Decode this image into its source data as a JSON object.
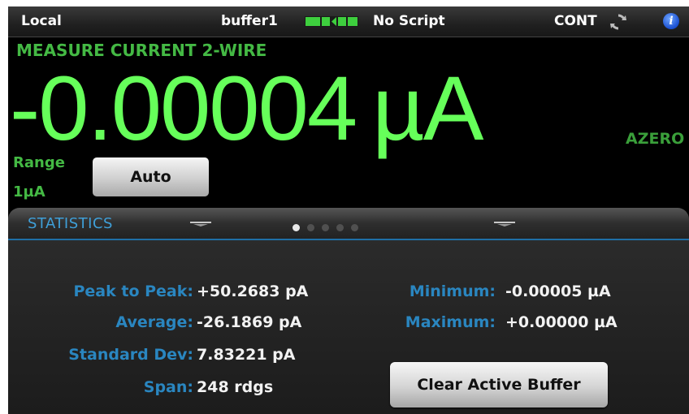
{
  "status_bar": {
    "mode": "Local",
    "buffer": "buffer1",
    "script": "No Script",
    "trigger": "CONT"
  },
  "icons": {
    "buffer": "buffer-fill-icon",
    "trigger": "continuous-trigger-icon",
    "info": "info-icon"
  },
  "measure": {
    "function": "MEASURE CURRENT 2-WIRE",
    "value": "-0.00004",
    "unit": "µA",
    "azero": "AZERO",
    "range_label": "Range",
    "range_value": "1µA",
    "range_button": "Auto"
  },
  "panel": {
    "title": "STATISTICS",
    "page_count": 5,
    "active_page": 1,
    "stats_left": [
      {
        "label": "Peak to Peak:",
        "value": "+50.2683 pA"
      },
      {
        "label": "Average:",
        "value": "-26.1869 pA"
      },
      {
        "label": "Standard Dev:",
        "value": "7.83221 pA"
      },
      {
        "label": "Span:",
        "value": "248 rdgs"
      }
    ],
    "stats_right": [
      {
        "label": "Minimum:",
        "value": "-0.00005 µA"
      },
      {
        "label": "Maximum:",
        "value": "+0.00000 µA"
      }
    ],
    "clear_button": "Clear Active Buffer"
  },
  "colors": {
    "reading": "#66ff5a",
    "label_green": "#44b944",
    "stat_label": "#2a86c0",
    "panel_title": "#3f9fd8"
  }
}
